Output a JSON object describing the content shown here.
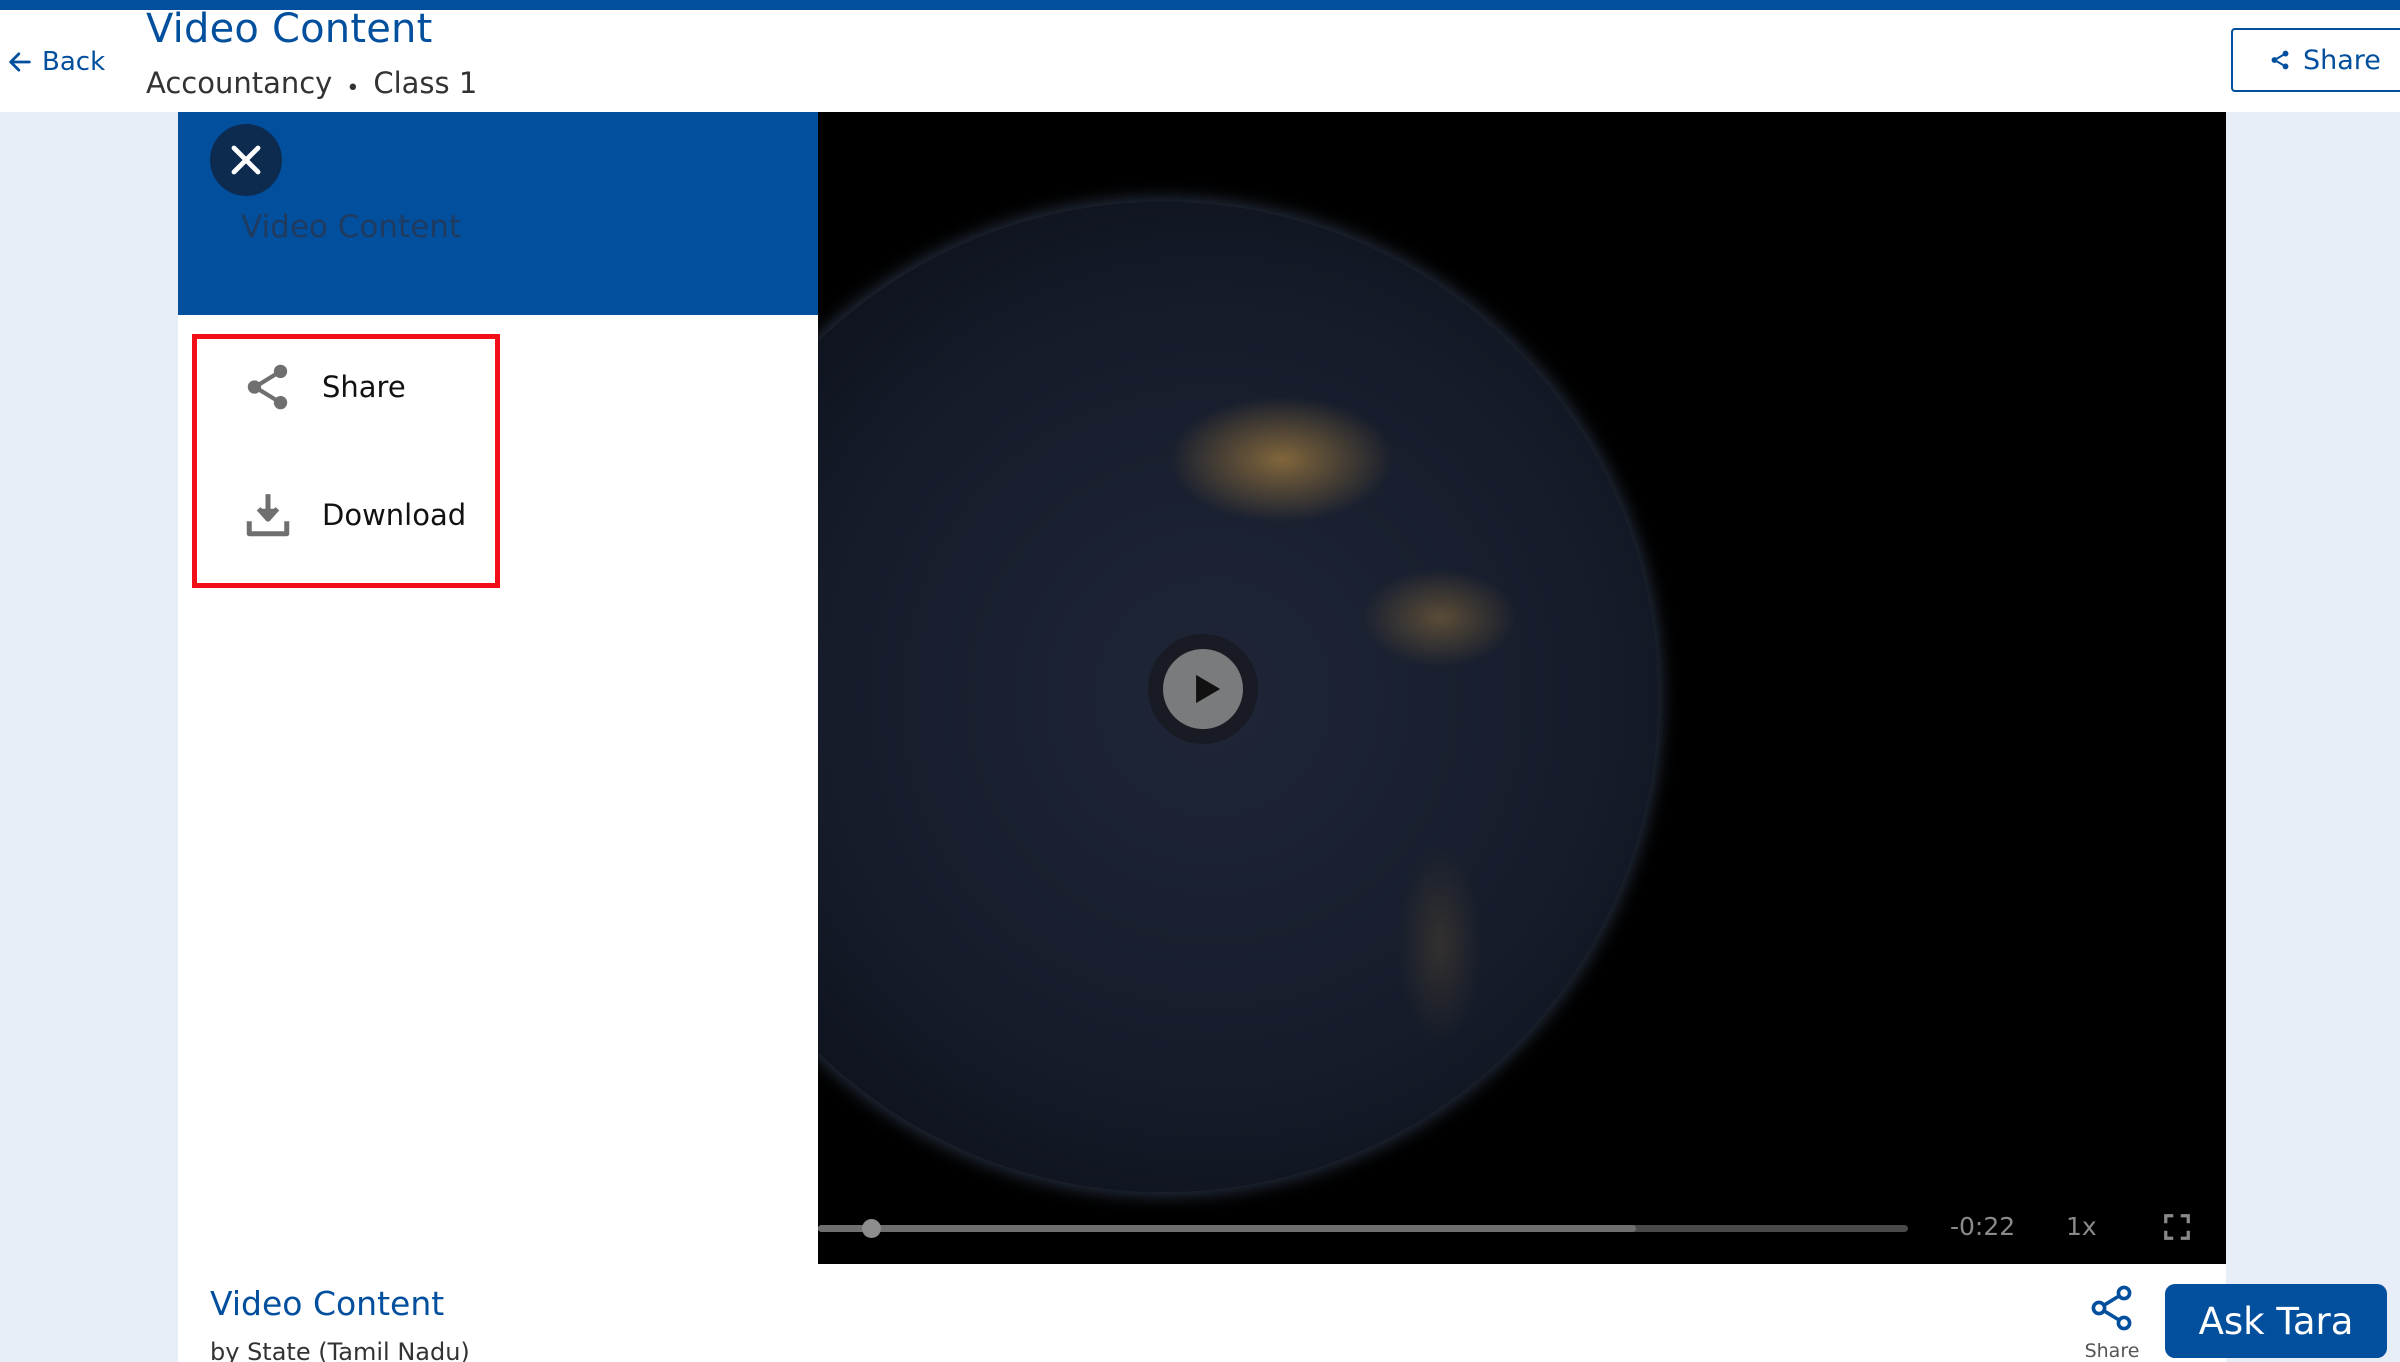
{
  "header": {
    "back_label": "Back",
    "title": "Video Content",
    "breadcrumb": [
      "Accountancy",
      "Class 1"
    ],
    "breadcrumb_separator": "•",
    "share_label": "Share"
  },
  "side_panel": {
    "title": "Video Content",
    "menu": [
      {
        "label": "Share",
        "icon": "share-icon"
      },
      {
        "label": "Download",
        "icon": "download-icon"
      }
    ]
  },
  "player": {
    "progress": 0.04,
    "buffered": 0.75,
    "time_remaining": "-0:22",
    "speed": "1x"
  },
  "content": {
    "title": "Video Content",
    "author": "by State (Tamil Nadu)",
    "share_label": "Share"
  },
  "assistant": {
    "label": "Ask Tara"
  },
  "colors": {
    "brand": "#024f9d",
    "highlight_border": "#f20f17",
    "background": "#e7eef7"
  }
}
